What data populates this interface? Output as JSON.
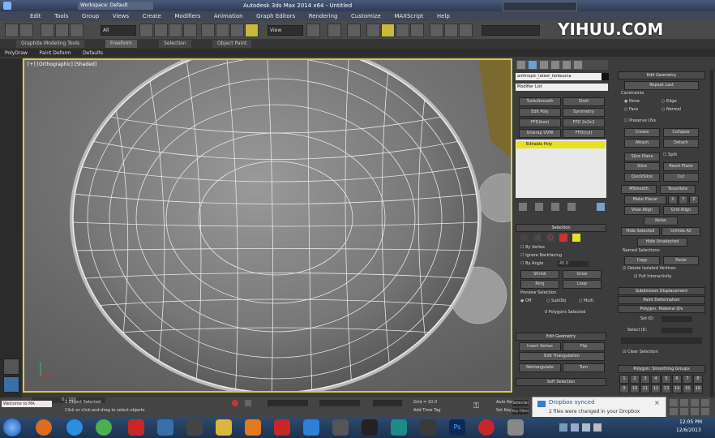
{
  "titlebar": {
    "workspace": "Workspace: Default",
    "title": "Autodesk 3ds Max 2014 x64 - Untitled"
  },
  "menubar": {
    "items": [
      "Edit",
      "Tools",
      "Group",
      "Views",
      "Create",
      "Modifiers",
      "Animation",
      "Graph Editors",
      "Rendering",
      "Customize",
      "MAXScript",
      "Help"
    ]
  },
  "toolbar": {
    "selection_filter": "All",
    "view": "View"
  },
  "ribbon": {
    "tabs": [
      "Graphite Modeling Tools",
      "Freeform",
      "Selection",
      "Object Paint"
    ]
  },
  "subribbon": {
    "items": [
      "PolyDraw",
      "Paint Deform",
      "Defaults"
    ]
  },
  "viewport": {
    "label": "[+] [Orthographic] [Shaded]"
  },
  "cmdpanel": {
    "object_name": "anthropic_latest_tenbuona",
    "modifier_list": "Modifier List",
    "buttons": [
      "TurboSmooth",
      "Shell",
      "Edit Poly",
      "Symmetry",
      "FFD(box)",
      "FFD 2x2x2",
      "Unwrap UVW",
      "FFD(cyl)"
    ],
    "stack_item": "Editable Poly",
    "selection_title": "Selection",
    "by_vertex": "By Vertex",
    "ignore_backfacing": "Ignore Backfacing",
    "by_angle": "By Angle",
    "angle_value": "45.0",
    "shrink": "Shrink",
    "grow": "Grow",
    "ring": "Ring",
    "loop": "Loop",
    "preview_title": "Preview Selection",
    "preview_off": "Off",
    "preview_subobj": "SubObj",
    "preview_multi": "Multi",
    "selected_count": "0 Polygons Selected",
    "edit_geometry": "Edit Geometry",
    "insert_vertex": "Insert Vertex",
    "flip": "Flip",
    "edit_triangulation": "Edit Triangulation",
    "retriangulate": "Retriangulate",
    "turn": "Turn",
    "soft_selection": "Soft Selection"
  },
  "rightpanel": {
    "edit_geometry": "Edit Geometry",
    "repeat_last": "Repeat Last",
    "constraints": "Constraints",
    "none": "None",
    "edge": "Edge",
    "face": "Face",
    "normal": "Normal",
    "preserve_uvs": "Preserve UVs",
    "create": "Create",
    "collapse": "Collapse",
    "attach": "Attach",
    "detach": "Detach",
    "slice_plane": "Slice Plane",
    "split": "Split",
    "slice": "Slice",
    "reset_plane": "Reset Plane",
    "quickslice": "QuickSlice",
    "cut": "Cut",
    "meshsmooth": "MSmooth",
    "tessellate": "Tessellate",
    "make_planar": "Make Planar",
    "x": "X",
    "y": "Y",
    "z": "Z",
    "view_align": "View Align",
    "grid_align": "Grid Align",
    "relax": "Relax",
    "hide_selected": "Hide Selected",
    "unhide_all": "Unhide All",
    "hide_unselected": "Hide Unselected",
    "named_selections": "Named Selections:",
    "copy": "Copy",
    "paste": "Paste",
    "delete_isolated": "Delete Isolated Vertices",
    "full_interactivity": "Full Interactivity",
    "subdivision": "Subdivision Displacement",
    "paint_deformation": "Paint Deformation",
    "polygon_material": "Polygon: Material IDs",
    "set_id": "Set ID:",
    "select_id": "Select ID:",
    "clear_selection": "Clear Selection",
    "smoothing_groups": "Polygon: Smoothing Groups",
    "sg_numbers": [
      "1",
      "2",
      "3",
      "4",
      "5",
      "6",
      "7",
      "8",
      "9",
      "10",
      "11",
      "12",
      "13",
      "14",
      "15",
      "16"
    ]
  },
  "status": {
    "frames": "0 / 100",
    "objects_selected": "1 Object Selected",
    "hint": "Click or click-and-drag to select objects",
    "welcome": "Welcome to MA",
    "grid": "Grid = 10.0",
    "auto_key": "Auto Key",
    "set_key": "Set Key",
    "add_time_tag": "Add Time Tag",
    "selected": "Selected",
    "key_filters": "Key Filters..."
  },
  "notification": {
    "title": "Dropbox synced",
    "message": "2 files were changed in your Dropbox"
  },
  "taskbar": {
    "time": "12:05 PM",
    "date": "12/6/2013"
  },
  "watermark": "YIHUU.COM",
  "colors": {
    "viewport_border": "#d9c74a",
    "stack_highlight": "#e8e020",
    "accent_red": "#d43030"
  }
}
